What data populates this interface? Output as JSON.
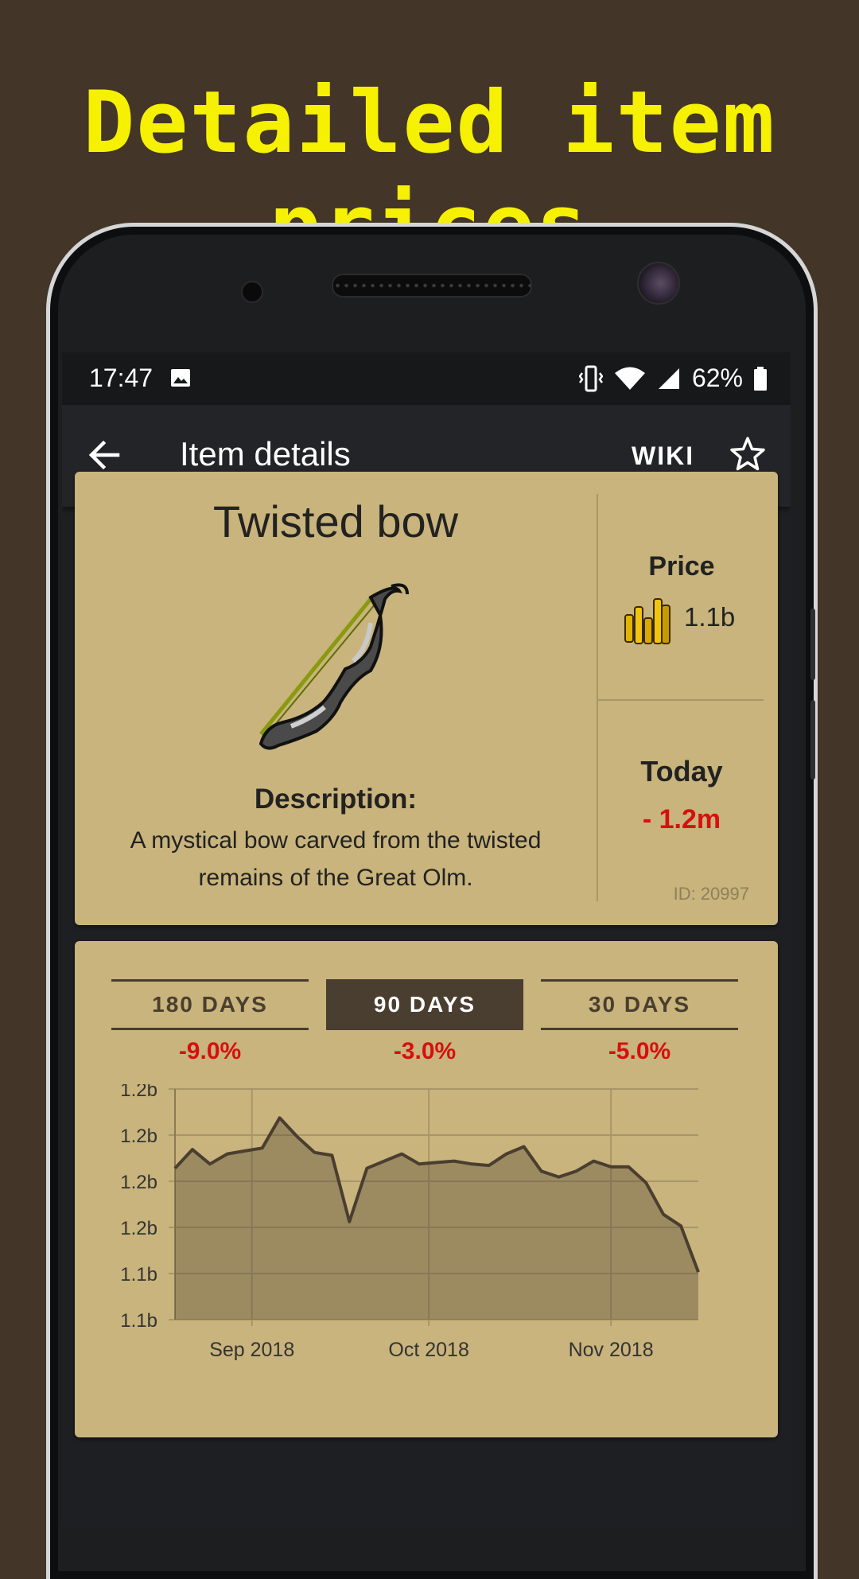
{
  "headline": "Detailed item prices",
  "status": {
    "time": "17:47",
    "battery": "62%"
  },
  "appbar": {
    "title": "Item details",
    "wiki": "WIKI"
  },
  "item": {
    "name": "Twisted bow",
    "description_heading": "Description:",
    "description": "A mystical bow carved from the twisted remains of the Great Olm.",
    "price_label": "Price",
    "price": "1.1b",
    "today_label": "Today",
    "today_change": "- 1.2m",
    "id_text": "ID: 20997"
  },
  "tabs": [
    {
      "label": "180 DAYS",
      "change": "-9.0%",
      "active": false
    },
    {
      "label": "90 DAYS",
      "change": "-3.0%",
      "active": true
    },
    {
      "label": "30 DAYS",
      "change": "-5.0%",
      "active": false
    }
  ],
  "colors": {
    "negative": "#d70f0f",
    "accent": "#4a3e30",
    "card": "#c8b47c",
    "headline": "#f6f100"
  },
  "chart_data": {
    "type": "area",
    "y_tick_labels": [
      "1.2b",
      "1.2b",
      "1.2b",
      "1.2b",
      "1.1b",
      "1.1b"
    ],
    "x_tick_labels": [
      "Sep 2018",
      "Oct 2018",
      "Nov 2018"
    ],
    "ylim": [
      1.08,
      1.24
    ],
    "grid": true,
    "x": [
      0,
      3,
      6,
      9,
      12,
      15,
      18,
      21,
      24,
      27,
      30,
      33,
      36,
      39,
      42,
      45,
      48,
      51,
      54,
      57,
      60,
      63,
      66,
      69,
      72,
      75,
      78,
      81,
      84,
      87,
      90
    ],
    "values": [
      1.185,
      1.198,
      1.188,
      1.195,
      1.197,
      1.199,
      1.22,
      1.207,
      1.196,
      1.194,
      1.148,
      1.185,
      1.19,
      1.195,
      1.188,
      1.189,
      1.19,
      1.188,
      1.187,
      1.195,
      1.2,
      1.183,
      1.179,
      1.183,
      1.19,
      1.186,
      1.186,
      1.175,
      1.153,
      1.145,
      1.113
    ]
  }
}
